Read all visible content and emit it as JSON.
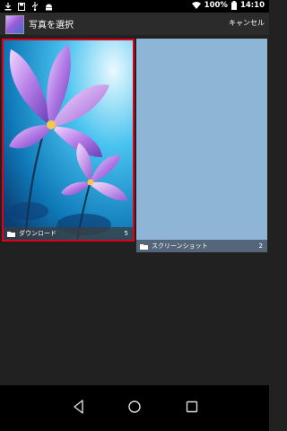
{
  "status": {
    "battery_percent": "100%",
    "time": "14:10"
  },
  "header": {
    "title": "写真を選択",
    "cancel": "キャンセル"
  },
  "albums": [
    {
      "name": "ダウンロード",
      "count": "5",
      "selected": true
    },
    {
      "name": "スクリーンショット",
      "count": "2",
      "selected": false
    }
  ],
  "colors": {
    "selection_border": "#e0001a",
    "screenshot_album_bg": "#8eb5d6"
  },
  "nav": {
    "back": "back-icon",
    "home": "home-icon",
    "recent": "recent-apps-icon"
  }
}
